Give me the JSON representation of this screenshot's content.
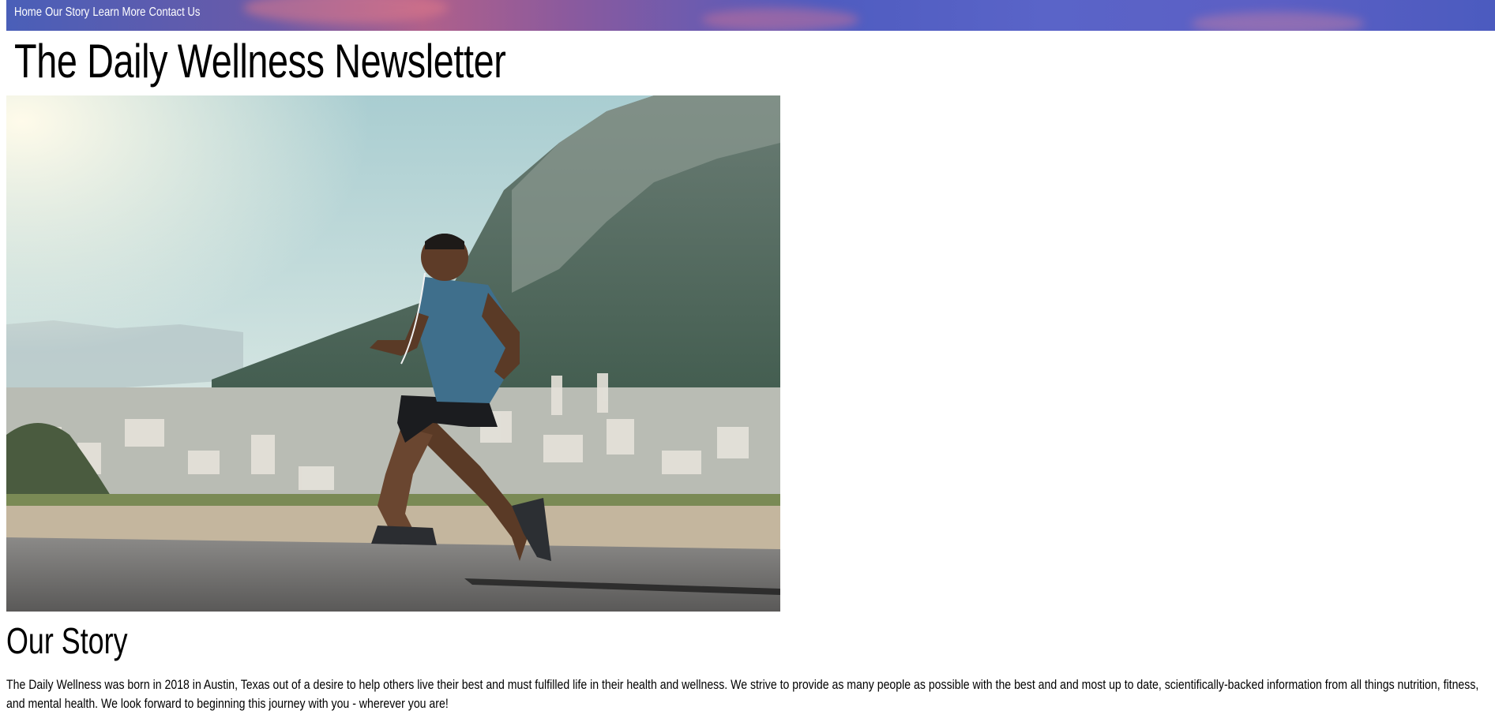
{
  "nav": {
    "links": [
      "Home",
      "Our Story",
      "Learn More",
      "Contact Us"
    ],
    "background_colors": [
      "#4a5fb8",
      "#b0608a",
      "#5c5fc4"
    ]
  },
  "header": {
    "title": "The Daily Wellness Newsletter"
  },
  "hero": {
    "image_subject": "runner-on-mountain-road"
  },
  "story": {
    "heading": "Our Story",
    "body": "The Daily Wellness was born in 2018 in Austin, Texas out of a desire to help others live their best and must fulfilled life in their health and wellness. We strive to provide as many people as possible with the best and and most up to date, scientifically-backed information from all things nutrition, fitness, and mental health. We look forward to beginning this journey with you - wherever you are!"
  }
}
